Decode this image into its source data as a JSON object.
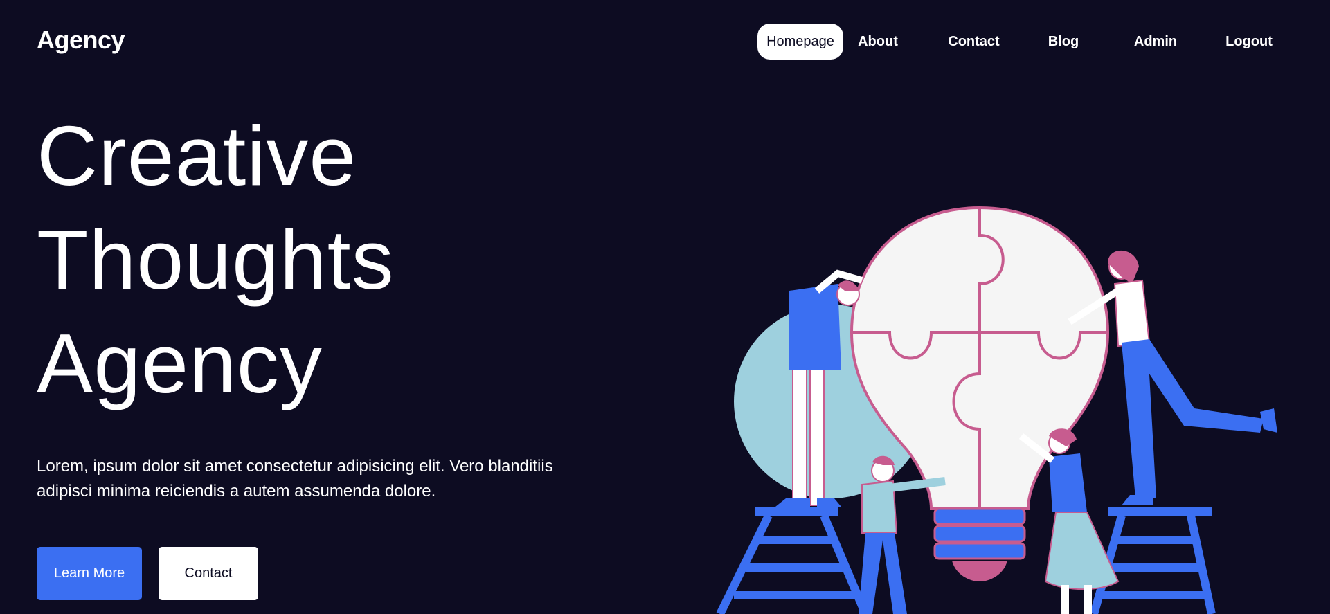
{
  "header": {
    "logo": "Agency",
    "nav": [
      {
        "label": "Homepage",
        "active": true
      },
      {
        "label": "About",
        "active": false
      },
      {
        "label": "Contact",
        "active": false
      },
      {
        "label": "Blog",
        "active": false
      },
      {
        "label": "Admin",
        "active": false
      },
      {
        "label": "Logout",
        "active": false
      }
    ]
  },
  "hero": {
    "title_lines": [
      "Creative",
      "Thoughts",
      "Agency"
    ],
    "description": "Lorem, ipsum dolor sit amet consectetur adipisicing elit. Vero blanditiis adipisci minima reiciendis a autem assumenda dolore.",
    "buttons": {
      "primary": "Learn More",
      "secondary": "Contact"
    },
    "illustration": "teamwork-lightbulb-puzzle"
  },
  "colors": {
    "background": "#0d0c22",
    "accent_blue": "#3b6ff2",
    "accent_pink": "#c75c8f",
    "accent_teal": "#9ed0de",
    "white": "#ffffff"
  }
}
